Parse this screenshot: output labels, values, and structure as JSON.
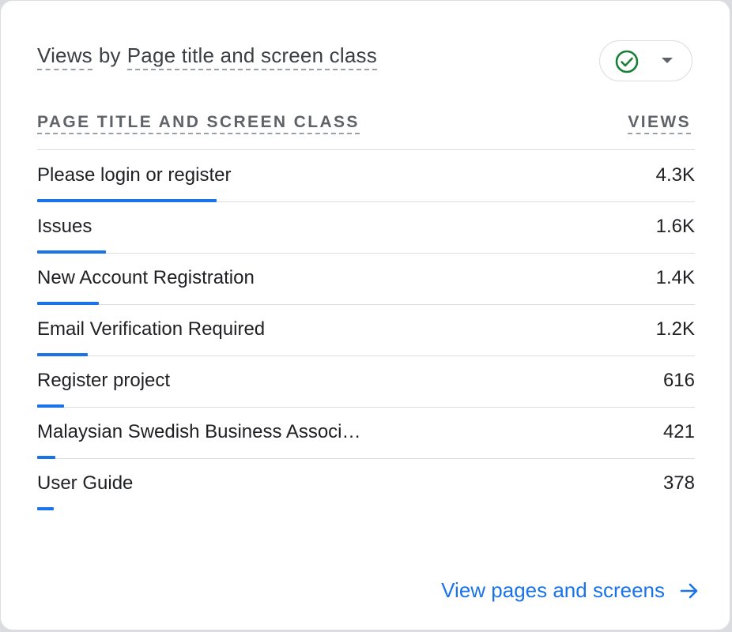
{
  "card": {
    "title_metric": "Views",
    "title_by": "by",
    "title_dimension": "Page title and screen class",
    "status_icon": "check-circle-icon",
    "status_color": "#188038"
  },
  "table": {
    "col_dimension": "PAGE TITLE AND SCREEN CLASS",
    "col_metric": "VIEWS",
    "rows": [
      {
        "label": "Please login or register",
        "value": "4.3K",
        "share": 0.273
      },
      {
        "label": "Issues",
        "value": "1.6K",
        "share": 0.104
      },
      {
        "label": "New Account Registration",
        "value": "1.4K",
        "share": 0.094
      },
      {
        "label": "Email Verification Required",
        "value": "1.2K",
        "share": 0.077
      },
      {
        "label": "Register project",
        "value": "616",
        "share": 0.041
      },
      {
        "label": "Malaysian Swedish Business Associ…",
        "value": "421",
        "share": 0.028
      },
      {
        "label": "User Guide",
        "value": "378",
        "share": 0.025
      }
    ]
  },
  "footer": {
    "link_label": "View pages and screens",
    "link_icon": "arrow-right-icon"
  },
  "colors": {
    "accent": "#1a73e8",
    "text": "#202124",
    "muted": "#5f6368",
    "divider": "#dadce0"
  }
}
